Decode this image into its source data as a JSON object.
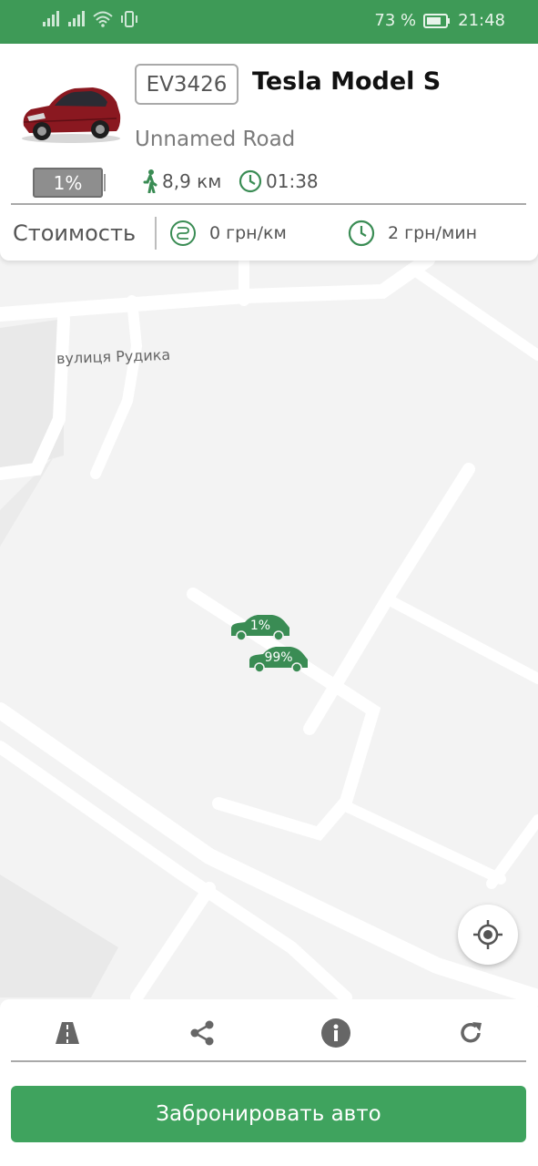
{
  "status_bar": {
    "battery_percent": "73 %",
    "time": "21:48"
  },
  "vehicle": {
    "plate": "EV3426",
    "model": "Tesla Model S",
    "address": "Unnamed Road",
    "battery_label": "1%",
    "battery_level": 0.01,
    "distance": "8,9 км",
    "walk_time": "01:38"
  },
  "pricing": {
    "label": "Стоимость",
    "per_km": "0 грн/км",
    "per_min": "2 грн/мин"
  },
  "map": {
    "street_label": "вулиця Рудика",
    "markers": [
      {
        "label": "1%"
      },
      {
        "label": "99%"
      }
    ]
  },
  "actions": {
    "book_label": "Забронировать авто"
  },
  "icons": [
    "signal-icon",
    "wifi-icon",
    "vibrate-icon",
    "battery-icon",
    "walk-icon",
    "clock-icon",
    "route-icon",
    "clock-icon",
    "locate-icon",
    "road-icon",
    "share-icon",
    "info-icon",
    "refresh-icon"
  ],
  "colors": {
    "brand": "#3e9a57",
    "button": "#3fa35e",
    "marker": "#3a8c54"
  }
}
